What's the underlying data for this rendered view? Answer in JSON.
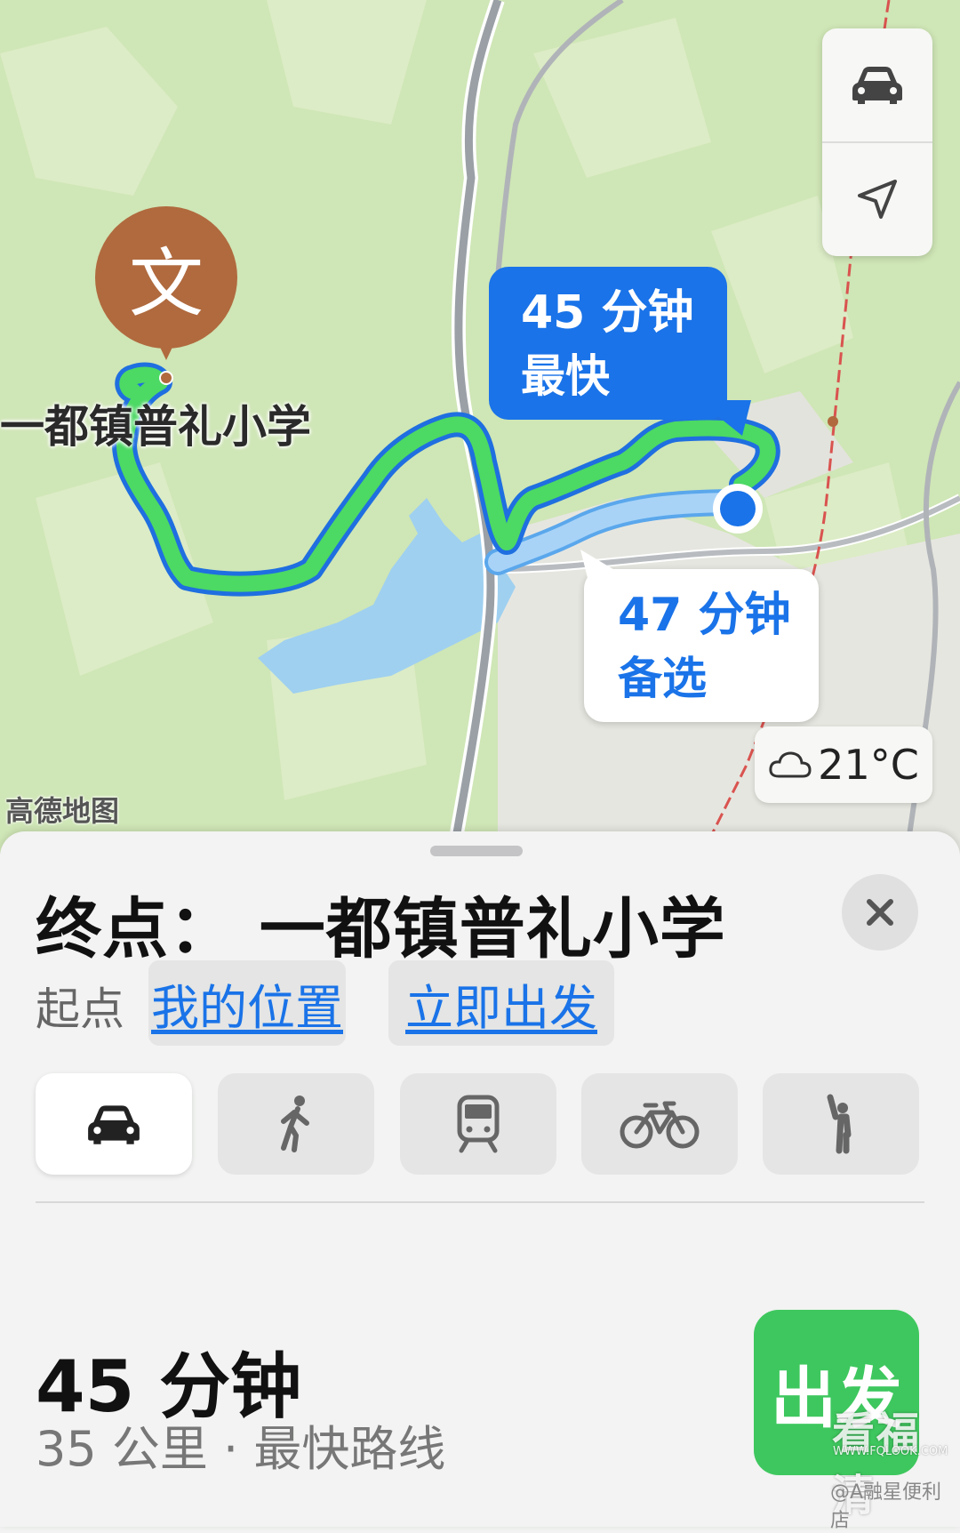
{
  "map": {
    "destination_pin_glyph": "文",
    "destination_label": "一都镇普礼小学",
    "fastest_callout": {
      "time": "45 分钟",
      "tag": "最快"
    },
    "alternate_callout": {
      "time": "47 分钟",
      "tag": "备选"
    },
    "weather": {
      "icon": "cloud-icon",
      "temperature": "21°C"
    },
    "attribution": "高德地图",
    "controls": [
      {
        "name": "car-icon"
      },
      {
        "name": "location-arrow-icon"
      }
    ],
    "colors": {
      "fastest_route": "#4cd964",
      "route_outline": "#1f6fe0",
      "alternate_route": "#86c3f5",
      "current_location": "#1a73e8",
      "land": "#cfe6b6",
      "water": "#9fd0f0"
    }
  },
  "sheet": {
    "title": "终点： 一都镇普礼小学",
    "start_label": "起点",
    "origin_chip": "我的位置",
    "time_chip": "立即出发",
    "modes": [
      {
        "name": "car-icon",
        "active": true
      },
      {
        "name": "walk-icon",
        "active": false
      },
      {
        "name": "transit-icon",
        "active": false
      },
      {
        "name": "bicycle-icon",
        "active": false
      },
      {
        "name": "rideshare-icon",
        "active": false
      }
    ],
    "route_time": "45 分钟",
    "route_info": "35 公里 · 最快路线",
    "go_button": "出发",
    "go_color": "#3ec75e"
  },
  "watermarks": {
    "brand": "看福清",
    "url": "WWW.FQLOOK.COM",
    "user": "@A融星便利店"
  }
}
